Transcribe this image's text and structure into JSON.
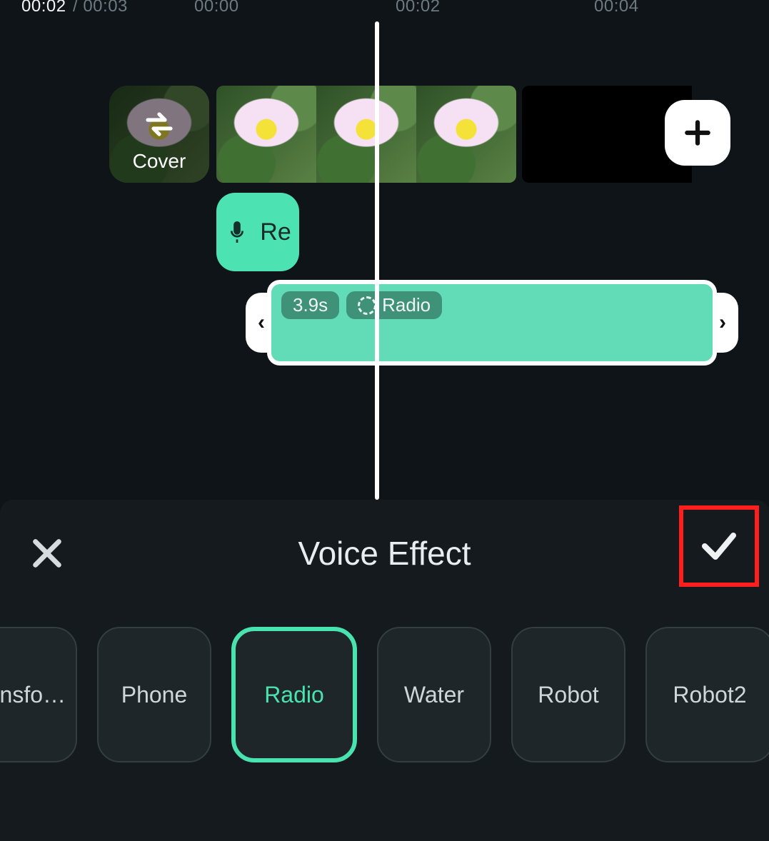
{
  "ruler": {
    "current": "00:02",
    "total_prefix": "/ 00:03",
    "marks": [
      "00:00",
      "00:02",
      "00:04"
    ]
  },
  "cover": {
    "label": "Cover"
  },
  "rec": {
    "label": "Re"
  },
  "audio_clip": {
    "duration": "3.9s",
    "effect": "Radio"
  },
  "sheet": {
    "title": "Voice Effect",
    "effects": [
      "ansfo…",
      "Phone",
      "Radio",
      "Water",
      "Robot",
      "Robot2"
    ],
    "selected_index": 2
  },
  "colors": {
    "accent": "#49e3b0",
    "highlight_box": "#ff1e1e"
  }
}
